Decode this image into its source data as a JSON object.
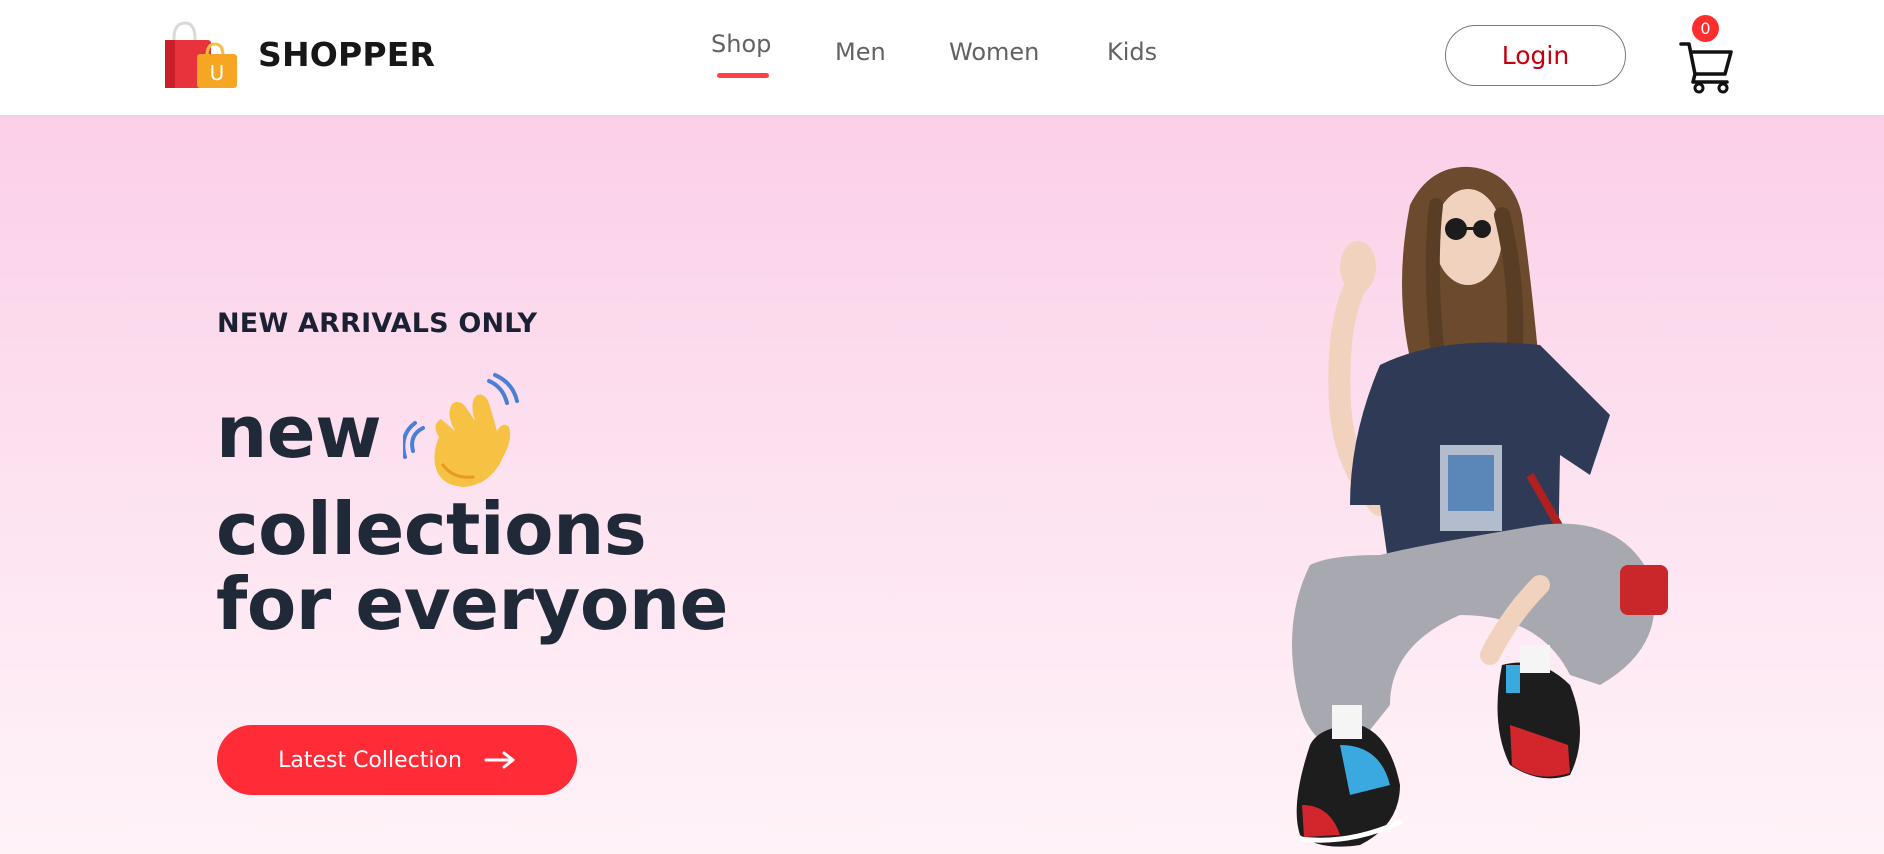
{
  "brand": {
    "name": "SHOPPER",
    "logo_icon": "shopping-bag-icon",
    "logo_letter": "U"
  },
  "nav": {
    "items": [
      {
        "label": "Shop",
        "active": true
      },
      {
        "label": "Men"
      },
      {
        "label": "Women"
      },
      {
        "label": "Kids"
      }
    ]
  },
  "header": {
    "login_label": "Login",
    "cart_icon": "cart-icon",
    "cart_count": "0"
  },
  "hero": {
    "tag": "NEW ARRIVALS ONLY",
    "line1": "new",
    "line2": "collections",
    "line3": "for everyone",
    "hand_icon": "waving-hand-icon",
    "cta_label": "Latest Collection",
    "cta_icon": "arrow-right-icon",
    "image": "fashion-model-photo"
  },
  "colors": {
    "accent": "#ff2b36",
    "login_text": "#c4000f",
    "hero_gradient_top": "#fbcfe8",
    "hero_gradient_bottom": "#fff3f8",
    "heading": "#1f2937"
  }
}
